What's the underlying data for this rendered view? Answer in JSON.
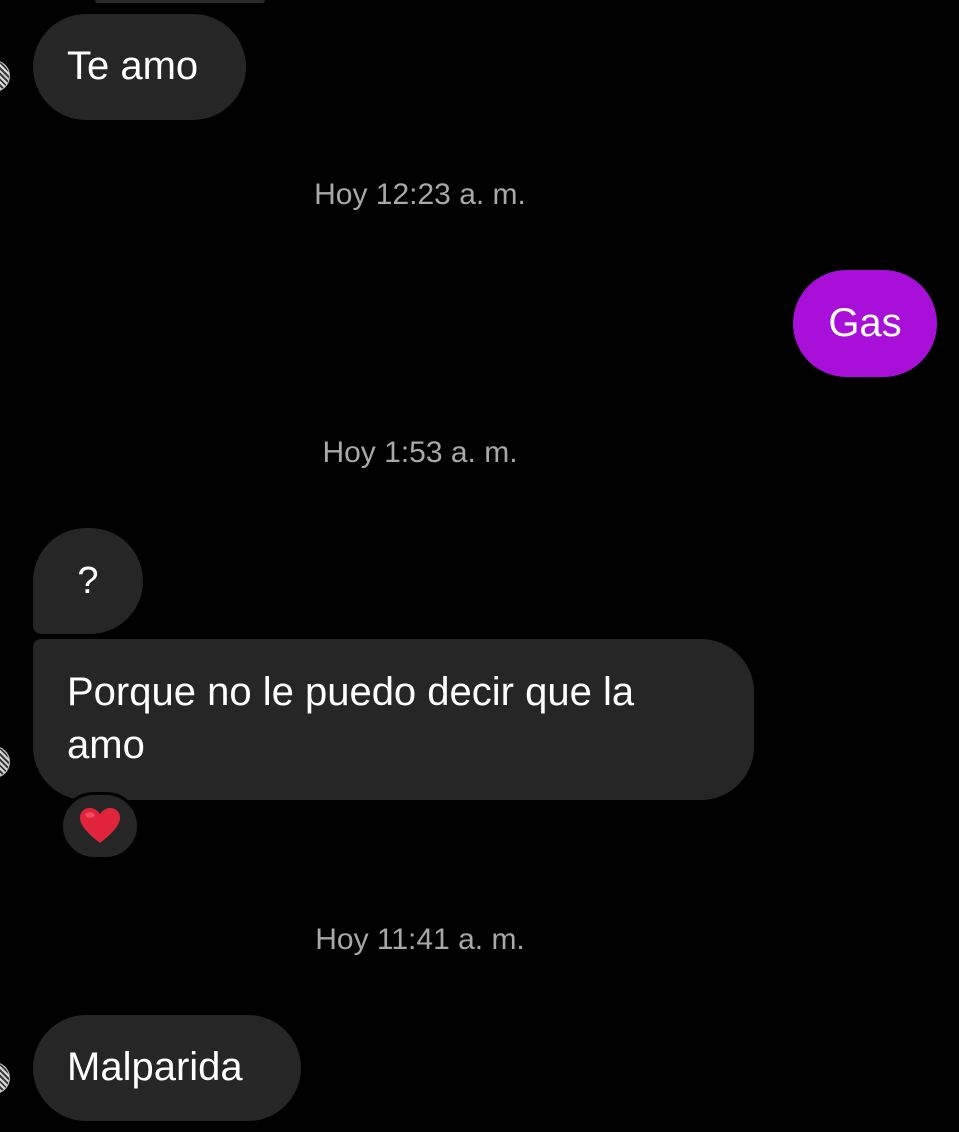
{
  "colors": {
    "background": "#000000",
    "incoming_bubble": "#262626",
    "outgoing_bubble": "#a80fd8",
    "timestamp_text": "#a8a8a8",
    "message_text": "#ffffff",
    "reaction_heart": "#e0243b"
  },
  "messages": {
    "te_amo": "Te amo",
    "gas": "Gas",
    "question": "?",
    "porque": "Porque no le puedo decir que la amo",
    "malparida": "Malparida"
  },
  "timestamps": {
    "t1": "Hoy 12:23 a. m.",
    "t2": "Hoy 1:53 a. m.",
    "t3": "Hoy 11:41 a. m."
  },
  "reaction": {
    "icon": "red-heart-icon"
  }
}
